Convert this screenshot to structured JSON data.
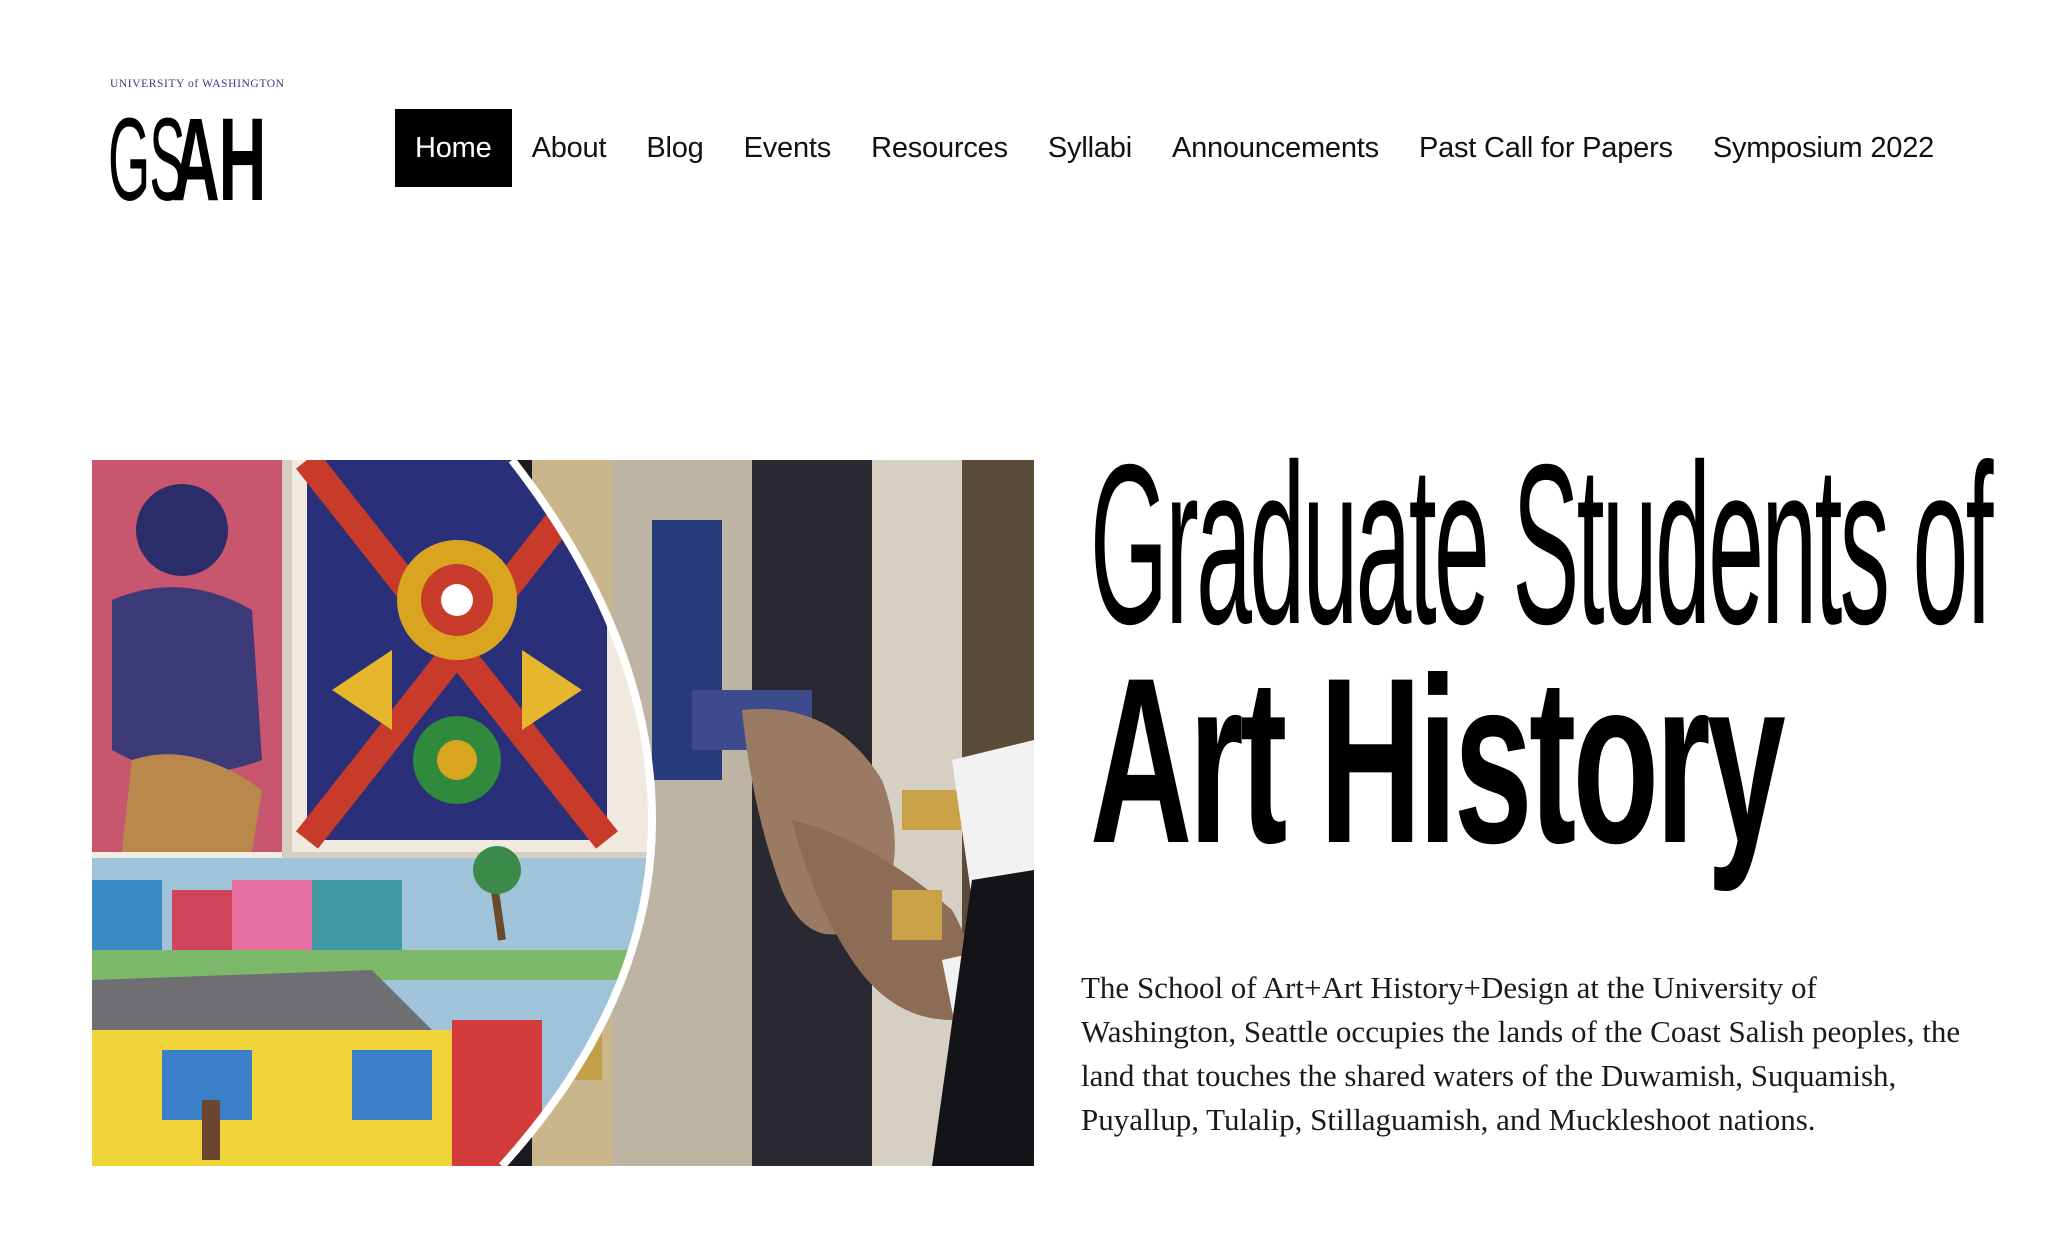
{
  "logo": {
    "university": "UNIVERSITY of WASHINGTON",
    "gs": "GS",
    "ah": "AH",
    "brand_color": "#4b2e83"
  },
  "nav": {
    "items": [
      {
        "label": "Home",
        "active": true
      },
      {
        "label": "About",
        "active": false
      },
      {
        "label": "Blog",
        "active": false
      },
      {
        "label": "Events",
        "active": false
      },
      {
        "label": "Resources",
        "active": false
      },
      {
        "label": "Syllabi",
        "active": false
      },
      {
        "label": "Announcements",
        "active": false
      },
      {
        "label": "Past Call for Papers",
        "active": false
      },
      {
        "label": "Symposium 2022",
        "active": false
      }
    ]
  },
  "hero": {
    "heading_line1": "Graduate Students of",
    "heading_line2": "Art History",
    "land_acknowledgement": "The School of Art+Art History+Design at the University of Washington, Seattle occupies the lands of the Coast Salish peoples, the land that touches the shared waters of the Duwamish, Suquamish, Puyallup, Tulalip, Stillaguamish, and Muckleshoot nations."
  }
}
